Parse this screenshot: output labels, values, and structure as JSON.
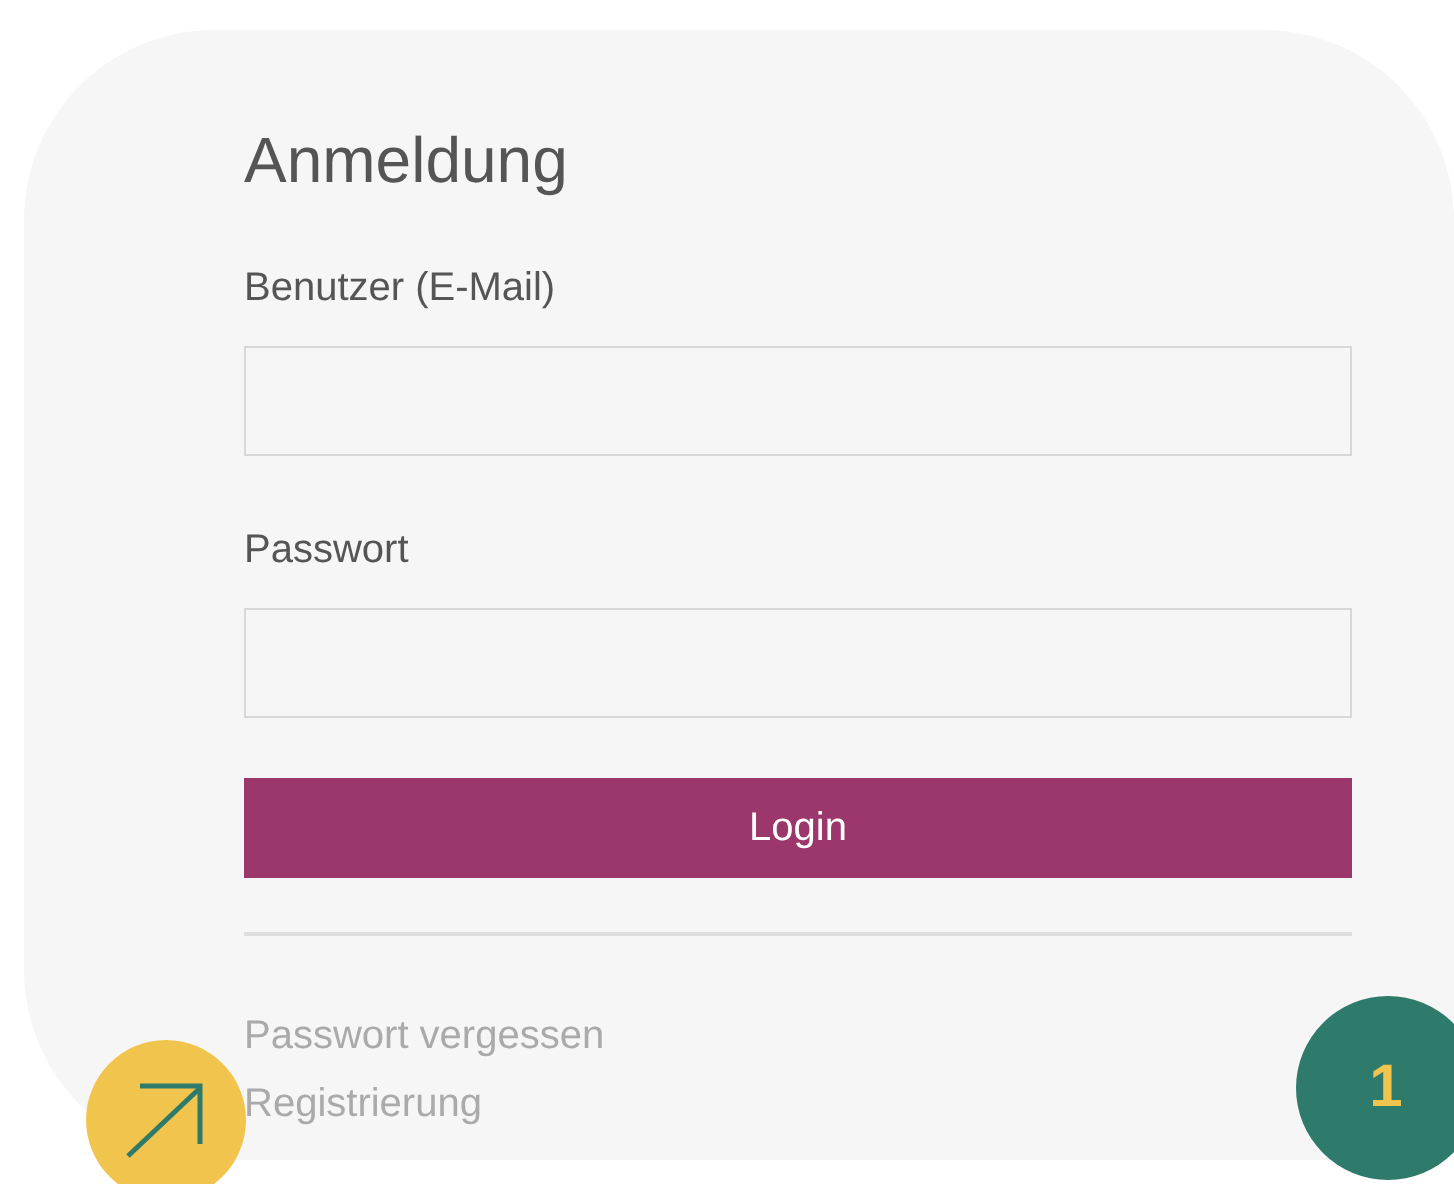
{
  "form": {
    "title": "Anmeldung",
    "fields": [
      {
        "label": "Benutzer (E-Mail)"
      },
      {
        "label": "Passwort"
      }
    ],
    "submit": "Login",
    "links": [
      "Passwort vergessen",
      "Registrierung"
    ]
  },
  "step_badge": {
    "number": "1"
  }
}
